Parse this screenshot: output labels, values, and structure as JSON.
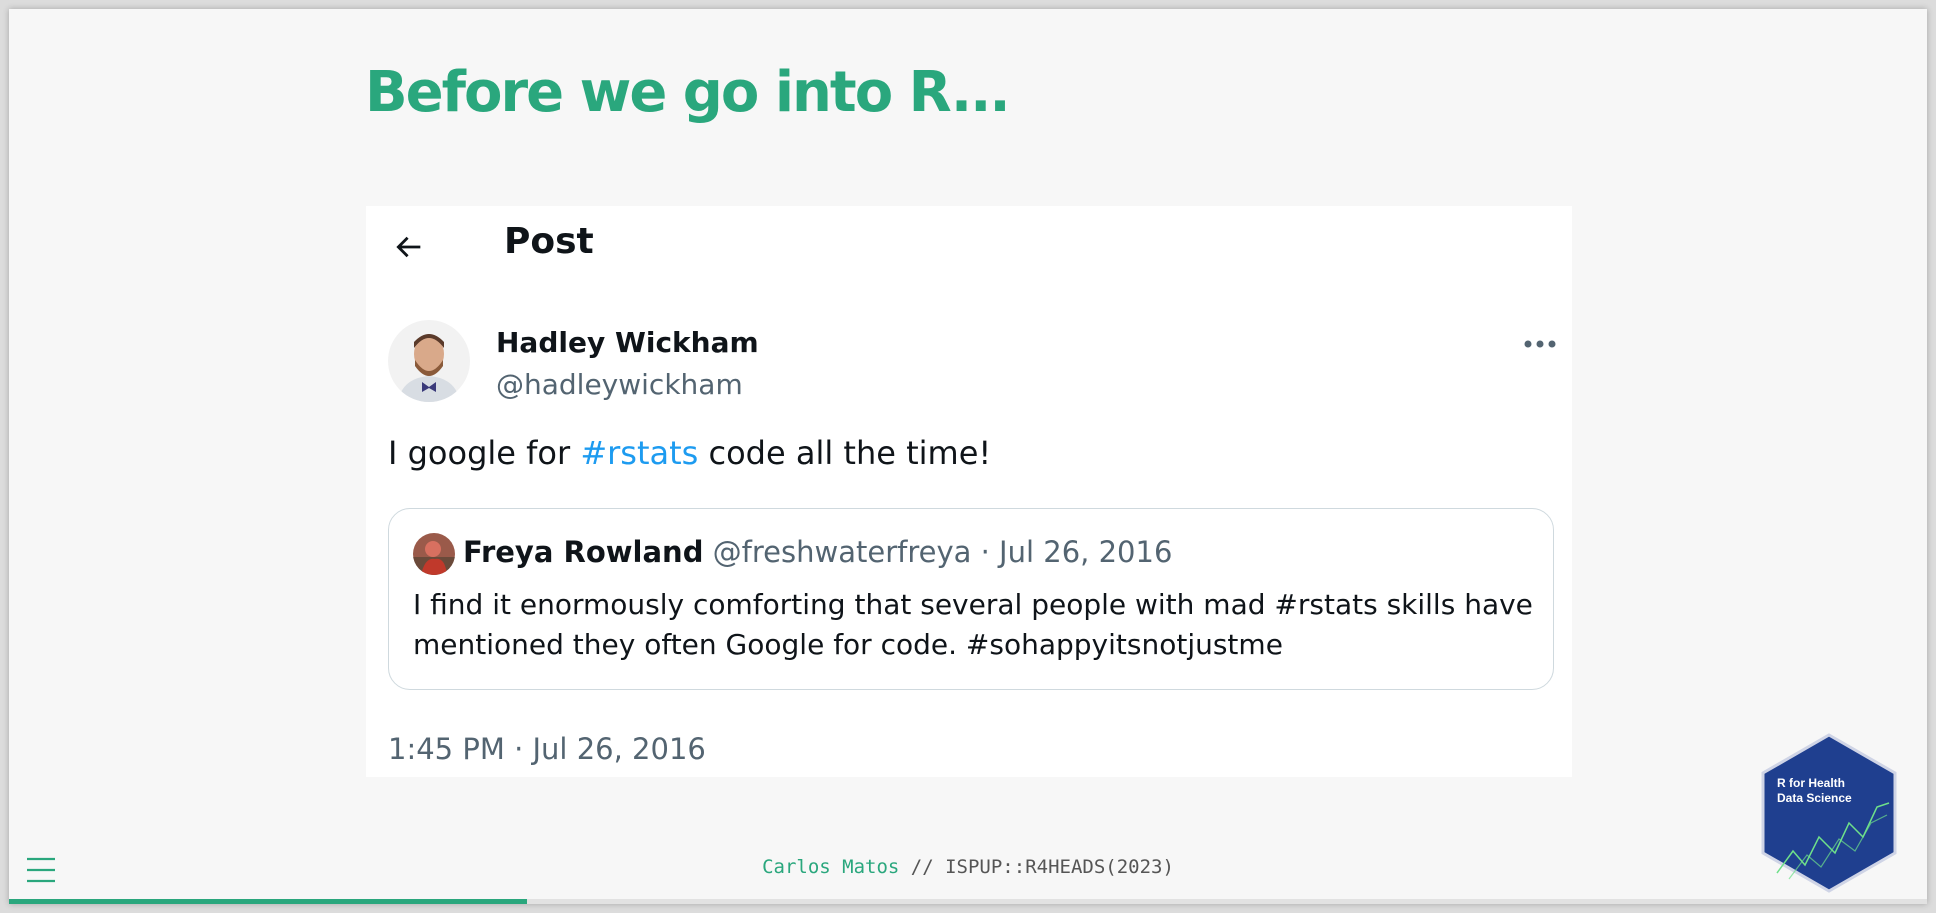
{
  "slide": {
    "title": "Before we go into R...",
    "progress": 0.27,
    "accent_color": "#2aa77d"
  },
  "tweet": {
    "header": "Post",
    "back_icon": "arrow-left-icon",
    "more_icon": "more-horizontal-icon",
    "author": {
      "name": "Hadley Wickham",
      "handle": "@hadleywickham"
    },
    "text_before": "I google for ",
    "hashtag": "#rstats",
    "text_after": " code all the time!",
    "quoted": {
      "name": "Freya Rowland",
      "meta": " @freshwaterfreya · Jul 26, 2016",
      "text": "I find it enormously comforting that several people with mad #rstats skills have mentioned they often Google for code. #sohappyitsnotjustme"
    },
    "timestamp": "1:45 PM · Jul 26, 2016",
    "link_color": "#1d9bf0"
  },
  "footer": {
    "author": "Carlos Matos",
    "rest": " // ISPUP::R4HEADS(2023)"
  },
  "logo": {
    "line1": "R for Health",
    "line2": "Data Science",
    "fill_color": "#1f3f8f"
  }
}
